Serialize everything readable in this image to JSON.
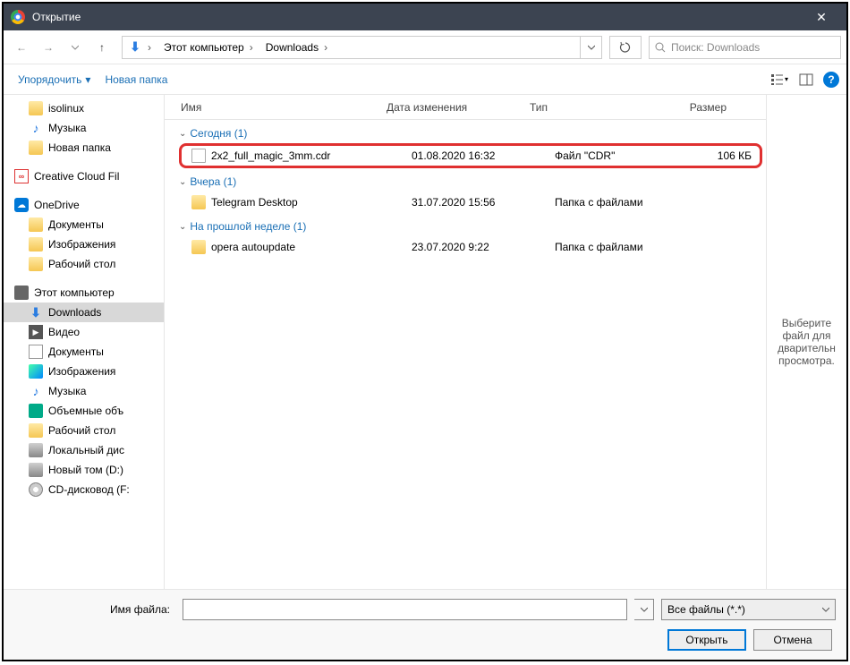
{
  "window": {
    "title": "Открытие"
  },
  "nav": {
    "breadcrumb": [
      "Этот компьютер",
      "Downloads"
    ],
    "search_placeholder": "Поиск: Downloads"
  },
  "toolbar": {
    "organize": "Упорядочить",
    "new_folder": "Новая папка"
  },
  "tree": [
    {
      "icon": "folder",
      "label": "isolinux",
      "level": 2
    },
    {
      "icon": "music",
      "label": "Музыка",
      "level": 2
    },
    {
      "icon": "folder",
      "label": "Новая папка",
      "level": 2
    },
    {
      "icon": "cc",
      "label": "Creative Cloud Fil",
      "level": 1,
      "spaced": true
    },
    {
      "icon": "onedrive",
      "label": "OneDrive",
      "level": 1,
      "spaced": true
    },
    {
      "icon": "folder",
      "label": "Документы",
      "level": 2
    },
    {
      "icon": "folder",
      "label": "Изображения",
      "level": 2
    },
    {
      "icon": "folder",
      "label": "Рабочий стол",
      "level": 2
    },
    {
      "icon": "pc",
      "label": "Этот компьютер",
      "level": 1,
      "spaced": true
    },
    {
      "icon": "dl",
      "label": "Downloads",
      "level": 2,
      "selected": true
    },
    {
      "icon": "video",
      "label": "Видео",
      "level": 2
    },
    {
      "icon": "doc",
      "label": "Документы",
      "level": 2
    },
    {
      "icon": "img",
      "label": "Изображения",
      "level": 2
    },
    {
      "icon": "music",
      "label": "Музыка",
      "level": 2
    },
    {
      "icon": "cube",
      "label": "Объемные объ",
      "level": 2
    },
    {
      "icon": "folder",
      "label": "Рабочий стол",
      "level": 2
    },
    {
      "icon": "drive",
      "label": "Локальный дис",
      "level": 2
    },
    {
      "icon": "drive",
      "label": "Новый том (D:)",
      "level": 2
    },
    {
      "icon": "cd",
      "label": "CD-дисковод (F:",
      "level": 2
    }
  ],
  "columns": {
    "name": "Имя",
    "date": "Дата изменения",
    "type": "Тип",
    "size": "Размер"
  },
  "groups": [
    {
      "label": "Сегодня (1)",
      "rows": [
        {
          "icon": "file",
          "name": "2x2_full_magic_3mm.cdr",
          "date": "01.08.2020 16:32",
          "type": "Файл \"CDR\"",
          "size": "106 КБ",
          "hl": true
        }
      ]
    },
    {
      "label": "Вчера (1)",
      "rows": [
        {
          "icon": "folder",
          "name": "Telegram Desktop",
          "date": "31.07.2020 15:56",
          "type": "Папка с файлами",
          "size": ""
        }
      ]
    },
    {
      "label": "На прошлой неделе (1)",
      "rows": [
        {
          "icon": "folder",
          "name": "opera autoupdate",
          "date": "23.07.2020 9:22",
          "type": "Папка с файлами",
          "size": ""
        }
      ]
    }
  ],
  "preview": {
    "text": "Выберите файл для дварительн просмотра."
  },
  "bottom": {
    "filename_label": "Имя файла:",
    "filename_value": "",
    "filter": "Все файлы (*.*)",
    "open": "Открыть",
    "cancel": "Отмена"
  }
}
